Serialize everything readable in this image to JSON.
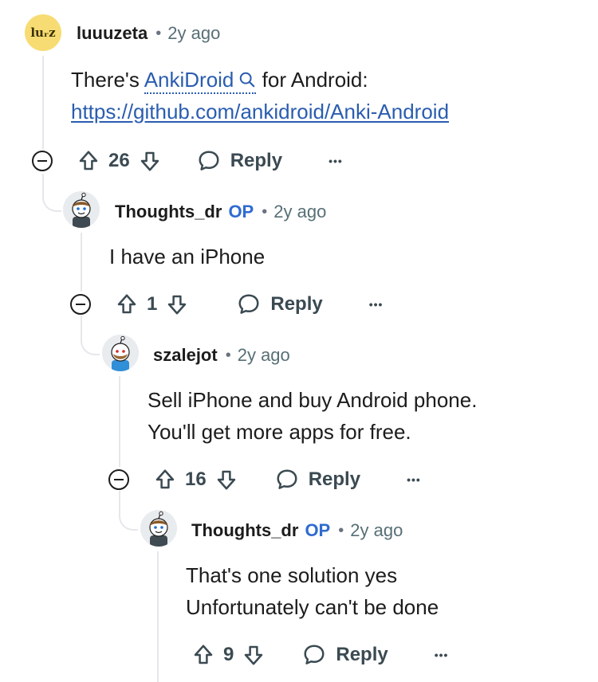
{
  "comments": [
    {
      "avatar_text": "luᵣᴢ",
      "username": "luuuzeta",
      "separator": "•",
      "time": "2y ago",
      "body": {
        "prefix": "There's",
        "link_label": "AnkiDroid",
        "suffix": "for Android:",
        "url": "https://github.com/ankidroid/Anki-Android"
      },
      "votes": "26",
      "reply_label": "Reply",
      "more_label": "•••"
    },
    {
      "username": "Thoughts_dr",
      "op_badge": "OP",
      "separator": "•",
      "time": "2y ago",
      "body_lines": [
        "I have an iPhone"
      ],
      "votes": "1",
      "reply_label": "Reply",
      "more_label": "•••"
    },
    {
      "username": "szalejot",
      "separator": "•",
      "time": "2y ago",
      "body_lines": [
        "Sell iPhone and buy Android phone.",
        "You'll get more apps for free."
      ],
      "votes": "16",
      "reply_label": "Reply",
      "more_label": "•••"
    },
    {
      "username": "Thoughts_dr",
      "op_badge": "OP",
      "separator": "•",
      "time": "2y ago",
      "body_lines": [
        "That's one solution yes",
        "Unfortunately can't be done"
      ],
      "votes": "9",
      "reply_label": "Reply",
      "more_label": "•••"
    }
  ],
  "colors": {
    "op_badge": "#2f6bd0",
    "link": "#2a5db0",
    "thread_line": "#e5e7eb",
    "avatar_yellow": "#f7dc73"
  }
}
